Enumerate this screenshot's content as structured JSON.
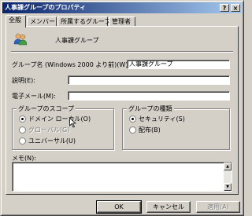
{
  "window": {
    "title": "人事課グループのプロパティ",
    "help_button": "?",
    "close_button": "×"
  },
  "tabs": [
    {
      "label": "全般",
      "active": true
    },
    {
      "label": "メンバー",
      "active": false
    },
    {
      "label": "所属するグループ",
      "active": false
    },
    {
      "label": "管理者",
      "active": false
    }
  ],
  "general": {
    "group_name_display": "人事課グループ",
    "pre2000_label": "グループ名 (Windows 2000 より前)(W):",
    "pre2000_value": "人事課グループ",
    "description_label": "説明(E):",
    "description_value": "",
    "email_label": "電子メール(M):",
    "email_value": ""
  },
  "scope": {
    "legend": "グループのスコープ",
    "options": [
      {
        "label": "ドメイン ローカル(O)",
        "selected": true,
        "enabled": true
      },
      {
        "label": "グローバル(G)",
        "selected": false,
        "enabled": false
      },
      {
        "label": "ユニバーサル(U)",
        "selected": false,
        "enabled": true
      }
    ]
  },
  "type": {
    "legend": "グループの種類",
    "options": [
      {
        "label": "セキュリティ(S)",
        "selected": true
      },
      {
        "label": "配布(B)",
        "selected": false
      }
    ]
  },
  "notes": {
    "label": "メモ(N):",
    "value": ""
  },
  "buttons": {
    "ok": "OK",
    "cancel": "キャンセル",
    "apply": "適用(A)"
  }
}
